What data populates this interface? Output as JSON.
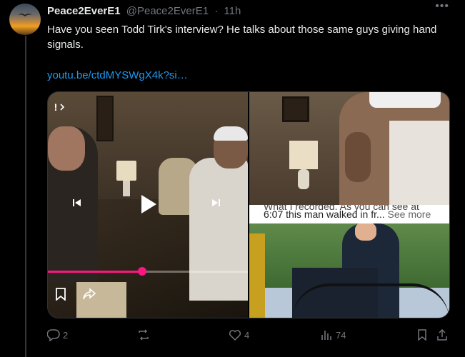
{
  "post": {
    "display_name": "Peace2EverE1",
    "handle": "@Peace2EverE1",
    "separator": "·",
    "time": "11h",
    "text": "Have you seen Todd Tirk's interview? He talks about those same guys giving hand signals.",
    "link": "youtu.be/ctdMYSWgX4k?si…"
  },
  "media": {
    "video_chip": "!",
    "progress_fraction": 0.47,
    "caption_line1": "What I recorded. As you can see at",
    "caption_line2": "6:07 this man walked in fr...",
    "see_more": "See more"
  },
  "actions": {
    "replies": "2",
    "reposts": "",
    "likes": "4",
    "views": "74"
  },
  "colors": {
    "accent": "#1d9bf0",
    "progress": "#f91880",
    "muted": "#71767b"
  },
  "icons": [
    "more-icon",
    "prev-icon",
    "play-icon",
    "next-icon",
    "bookmark-icon",
    "share-icon",
    "reply-icon",
    "repost-icon",
    "like-icon",
    "views-icon",
    "bookmark-action-icon",
    "share-action-icon"
  ]
}
